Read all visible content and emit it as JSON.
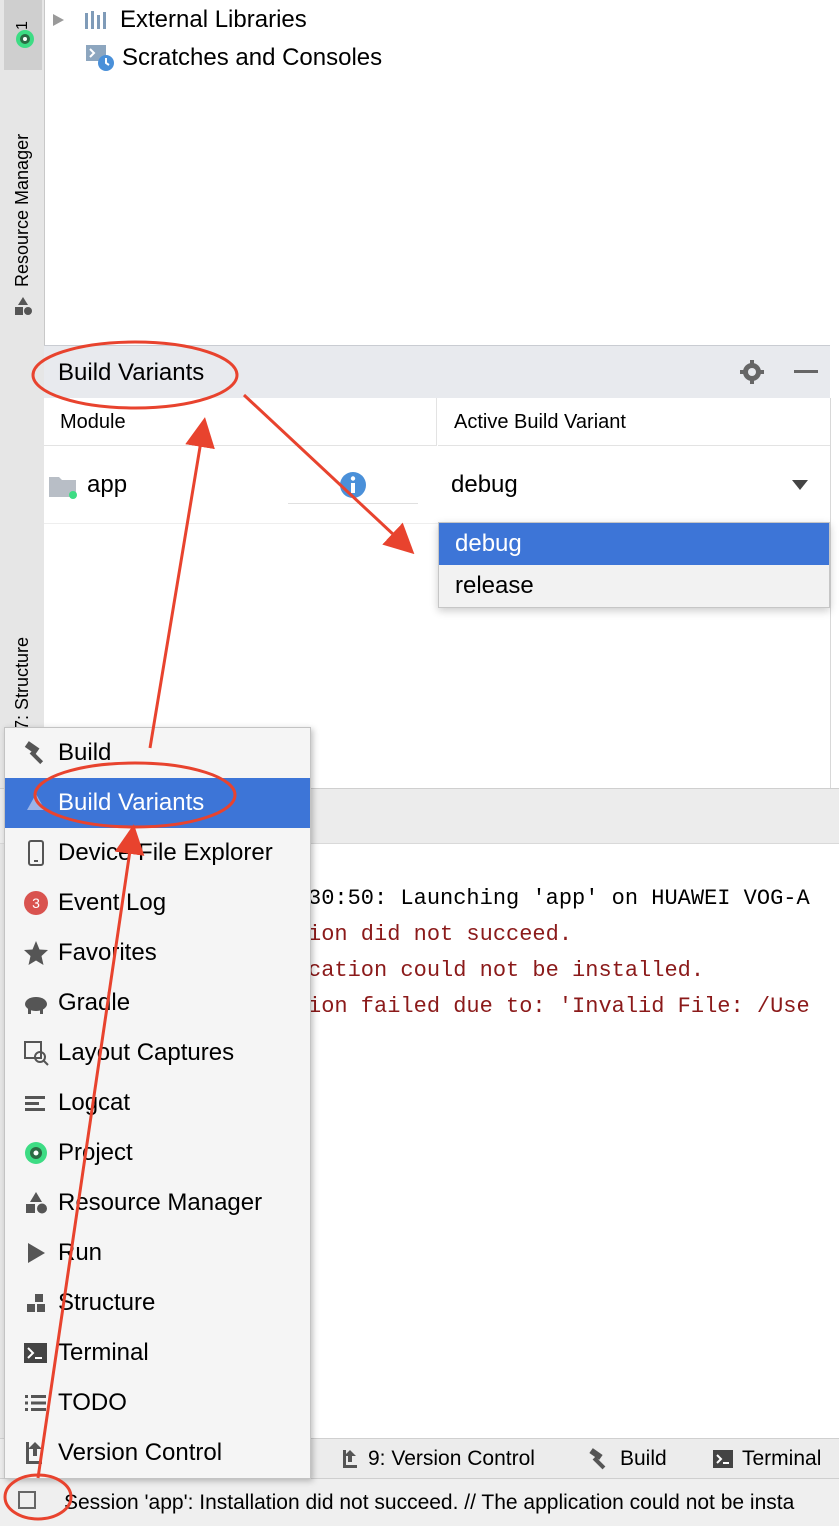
{
  "sidebar": {
    "resource_manager_label": "Resource Manager",
    "structure_label": "7: Structure",
    "top_tab_label": "1"
  },
  "project_tree": {
    "items": [
      {
        "label": "External Libraries",
        "icon": "library-icon"
      },
      {
        "label": "Scratches and Consoles",
        "icon": "scratches-icon"
      }
    ]
  },
  "build_variants": {
    "title": "Build Variants",
    "columns": [
      "Module",
      "Active Build Variant"
    ],
    "rows": [
      {
        "module": "app",
        "variant": "debug"
      }
    ],
    "dropdown_options": [
      "debug",
      "release"
    ],
    "selected_option": "debug"
  },
  "run_console": {
    "lines": [
      {
        "text": "30:50: Launching 'app' on HUAWEI VOG-A",
        "color": "#000000"
      },
      {
        "text": "ion did not succeed.",
        "color": "#8b1a1a"
      },
      {
        "text": "cation could not be installed.",
        "color": "#8b1a1a"
      },
      {
        "text": "ion failed due to: 'Invalid File: /Use",
        "color": "#8b1a1a"
      }
    ]
  },
  "tool_menu": {
    "items": [
      {
        "label": "Build",
        "icon": "hammer-icon"
      },
      {
        "label": "Build Variants",
        "icon": "build-variants-icon",
        "selected": true
      },
      {
        "label": "Device File Explorer",
        "icon": "device-icon"
      },
      {
        "label": "Event Log",
        "icon": "event-log-icon",
        "badge": "3"
      },
      {
        "label": "Favorites",
        "icon": "star-icon"
      },
      {
        "label": "Gradle",
        "icon": "gradle-icon"
      },
      {
        "label": "Layout Captures",
        "icon": "layout-capture-icon"
      },
      {
        "label": "Logcat",
        "icon": "logcat-icon"
      },
      {
        "label": "Project",
        "icon": "android-project-icon"
      },
      {
        "label": "Resource Manager",
        "icon": "resource-manager-icon"
      },
      {
        "label": "Run",
        "icon": "run-icon"
      },
      {
        "label": "Structure",
        "icon": "structure-icon"
      },
      {
        "label": "Terminal",
        "icon": "terminal-icon"
      },
      {
        "label": "TODO",
        "icon": "todo-icon"
      },
      {
        "label": "Version Control",
        "icon": "version-control-icon"
      }
    ]
  },
  "tool_tabs": [
    {
      "label": "9: Version Control",
      "icon": "version-control-icon"
    },
    {
      "label": "Build",
      "icon": "hammer-icon"
    },
    {
      "label": "Terminal",
      "icon": "terminal-icon"
    }
  ],
  "status_bar": {
    "message": "Session 'app': Installation did not succeed. // The application could not be insta"
  },
  "colors": {
    "selection": "#3d75d7",
    "annotation": "#e8432e",
    "error_text": "#8b1a1a",
    "info_icon": "#4a90d9"
  }
}
